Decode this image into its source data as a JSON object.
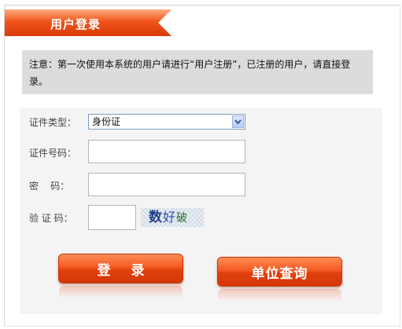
{
  "header": {
    "title": "用户登录"
  },
  "notice": {
    "text": "注意：第一次使用本系统的用户请进行“用户注册”，已注册的用户，请直接登录。"
  },
  "form": {
    "id_type": {
      "label": "证件类型：",
      "value": "身份证"
    },
    "id_number": {
      "label": "证件号码：",
      "value": ""
    },
    "password": {
      "label": "密    码：",
      "value": ""
    },
    "captcha": {
      "label": "验 证 码：",
      "value": "",
      "image_text": [
        "数",
        "好",
        "破"
      ]
    }
  },
  "buttons": {
    "login": "登 录",
    "unit_query": "单位查询"
  },
  "colors": {
    "accent": "#f0541b",
    "notice_bg": "#dcdcdc",
    "panel_bg": "#f4f4f4"
  }
}
